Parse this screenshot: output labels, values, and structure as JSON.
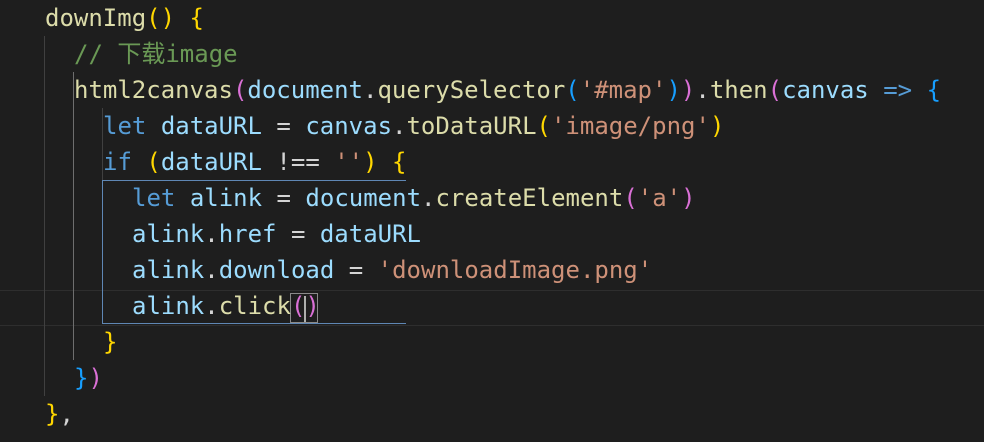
{
  "colors": {
    "background": "#1e1e1e",
    "function": "#dcdcaa",
    "variable": "#9cdcfe",
    "keyword": "#569cd6",
    "string": "#ce9178",
    "comment": "#6a9955",
    "default": "#d4d4d4",
    "bracket_gold": "#ffd700",
    "bracket_purple": "#da70d6",
    "bracket_blue": "#179fff"
  },
  "code_lines": [
    {
      "indent": 1,
      "tokens": [
        {
          "text": "downImg",
          "kind": "function"
        },
        {
          "text": "()",
          "kind": "bracket_gold"
        },
        {
          "text": " ",
          "kind": "default"
        },
        {
          "text": "{",
          "kind": "bracket_gold"
        }
      ]
    },
    {
      "indent": 2,
      "tokens": [
        {
          "text": "// 下载image",
          "kind": "comment"
        }
      ]
    },
    {
      "indent": 2,
      "tokens": [
        {
          "text": "html2canvas",
          "kind": "function"
        },
        {
          "text": "(",
          "kind": "bracket_purple"
        },
        {
          "text": "document",
          "kind": "variable"
        },
        {
          "text": ".",
          "kind": "default"
        },
        {
          "text": "querySelector",
          "kind": "function"
        },
        {
          "text": "(",
          "kind": "bracket_blue"
        },
        {
          "text": "'#map'",
          "kind": "string"
        },
        {
          "text": ")",
          "kind": "bracket_blue"
        },
        {
          "text": ")",
          "kind": "bracket_purple"
        },
        {
          "text": ".",
          "kind": "default"
        },
        {
          "text": "then",
          "kind": "function"
        },
        {
          "text": "(",
          "kind": "bracket_purple"
        },
        {
          "text": "canvas",
          "kind": "variable"
        },
        {
          "text": " ",
          "kind": "default"
        },
        {
          "text": "=>",
          "kind": "keyword"
        },
        {
          "text": " ",
          "kind": "default"
        },
        {
          "text": "{",
          "kind": "bracket_blue"
        }
      ]
    },
    {
      "indent": 3,
      "tokens": [
        {
          "text": "let",
          "kind": "keyword"
        },
        {
          "text": " ",
          "kind": "default"
        },
        {
          "text": "dataURL",
          "kind": "variable"
        },
        {
          "text": " = ",
          "kind": "default"
        },
        {
          "text": "canvas",
          "kind": "variable"
        },
        {
          "text": ".",
          "kind": "default"
        },
        {
          "text": "toDataURL",
          "kind": "function"
        },
        {
          "text": "(",
          "kind": "bracket_gold"
        },
        {
          "text": "'image/png'",
          "kind": "string"
        },
        {
          "text": ")",
          "kind": "bracket_gold"
        }
      ]
    },
    {
      "indent": 3,
      "tokens": [
        {
          "text": "if",
          "kind": "keyword"
        },
        {
          "text": " ",
          "kind": "default"
        },
        {
          "text": "(",
          "kind": "bracket_gold"
        },
        {
          "text": "dataURL",
          "kind": "variable"
        },
        {
          "text": " !== ",
          "kind": "default"
        },
        {
          "text": "''",
          "kind": "string"
        },
        {
          "text": ")",
          "kind": "bracket_gold"
        },
        {
          "text": " ",
          "kind": "default"
        },
        {
          "text": "{",
          "kind": "bracket_gold"
        }
      ]
    },
    {
      "indent": 4,
      "tokens": [
        {
          "text": "let",
          "kind": "keyword"
        },
        {
          "text": " ",
          "kind": "default"
        },
        {
          "text": "alink",
          "kind": "variable"
        },
        {
          "text": " = ",
          "kind": "default"
        },
        {
          "text": "document",
          "kind": "variable"
        },
        {
          "text": ".",
          "kind": "default"
        },
        {
          "text": "createElement",
          "kind": "function"
        },
        {
          "text": "(",
          "kind": "bracket_purple"
        },
        {
          "text": "'a'",
          "kind": "string"
        },
        {
          "text": ")",
          "kind": "bracket_purple"
        }
      ]
    },
    {
      "indent": 4,
      "tokens": [
        {
          "text": "alink",
          "kind": "variable"
        },
        {
          "text": ".",
          "kind": "default"
        },
        {
          "text": "href",
          "kind": "variable"
        },
        {
          "text": " = ",
          "kind": "default"
        },
        {
          "text": "dataURL",
          "kind": "variable"
        }
      ]
    },
    {
      "indent": 4,
      "tokens": [
        {
          "text": "alink",
          "kind": "variable"
        },
        {
          "text": ".",
          "kind": "default"
        },
        {
          "text": "download",
          "kind": "variable"
        },
        {
          "text": " = ",
          "kind": "default"
        },
        {
          "text": "'downloadImage.png'",
          "kind": "string"
        }
      ]
    },
    {
      "indent": 4,
      "tokens": [
        {
          "text": "alink",
          "kind": "variable"
        },
        {
          "text": ".",
          "kind": "default"
        },
        {
          "text": "click",
          "kind": "function"
        },
        {
          "text": "()",
          "kind": "bracket_purple"
        }
      ]
    },
    {
      "indent": 3,
      "tokens": [
        {
          "text": "}",
          "kind": "bracket_gold"
        }
      ]
    },
    {
      "indent": 2,
      "tokens": [
        {
          "text": "}",
          "kind": "bracket_blue"
        },
        {
          "text": ")",
          "kind": "bracket_purple"
        }
      ]
    },
    {
      "indent": 1,
      "tokens": [
        {
          "text": "}",
          "kind": "bracket_gold"
        },
        {
          "text": ",",
          "kind": "default"
        }
      ]
    }
  ]
}
